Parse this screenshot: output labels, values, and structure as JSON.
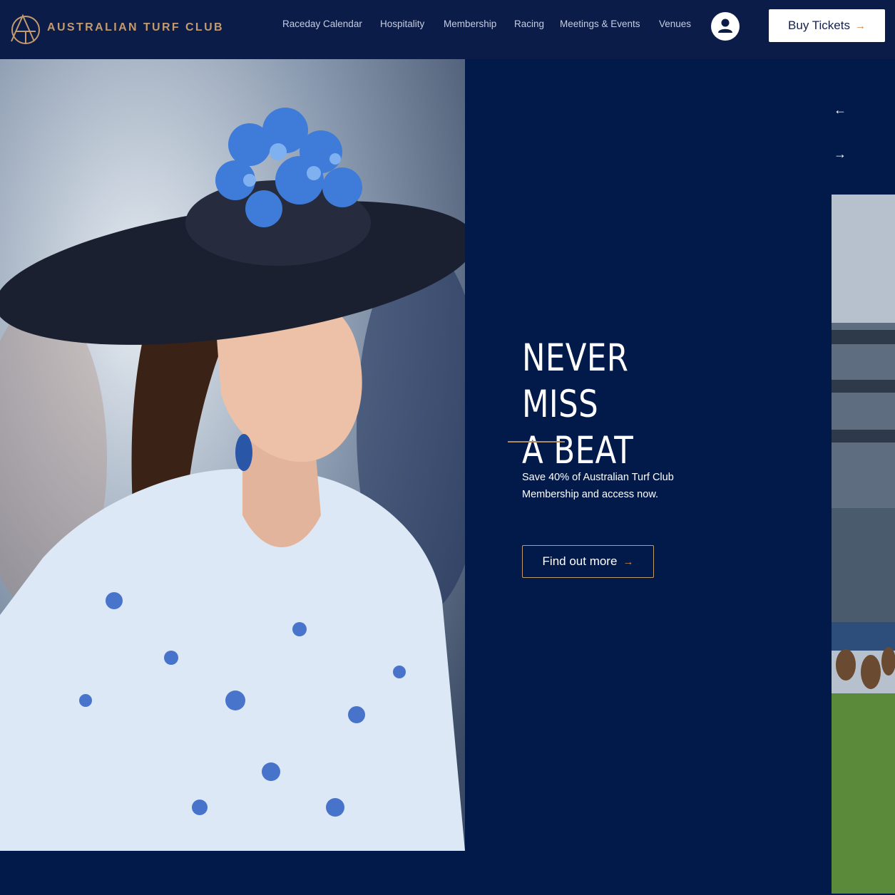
{
  "header": {
    "brand": "AUSTRALIAN TURF CLUB",
    "nav": [
      {
        "label": "Raceday Calendar"
      },
      {
        "label": "Hospitality"
      },
      {
        "label": "Membership"
      },
      {
        "label": "Racing"
      },
      {
        "label": "Meetings & Events"
      },
      {
        "label": "Venues"
      }
    ],
    "buy_tickets": "Buy Tickets",
    "arrow": "→"
  },
  "hero": {
    "title_line1": "NEVER MISS",
    "title_line2": "A BEAT",
    "description": "Save 40% of Australian Turf Club Membership and access now.",
    "cta": "Find out more",
    "cta_arrow": "→",
    "prev": "←",
    "next": "→"
  },
  "colors": {
    "header_bg": "#0a1c47",
    "panel_bg": "#021a4a",
    "accent_gold": "#c49a6c",
    "button_white": "#ffffff"
  },
  "icons": {
    "logo": "atc-monogram-logo",
    "account": "user-icon",
    "arrow_left": "arrow-left-icon",
    "arrow_right": "arrow-right-icon"
  }
}
